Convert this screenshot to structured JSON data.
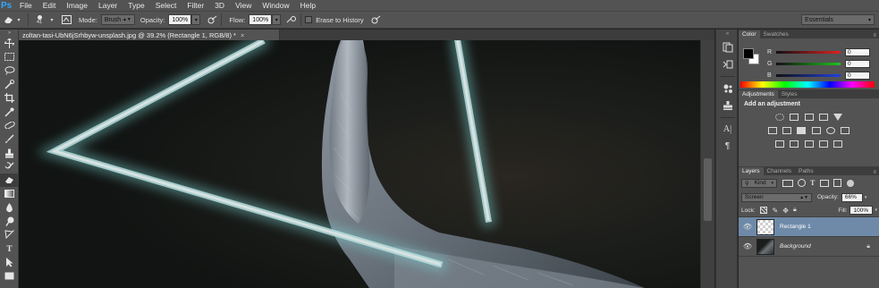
{
  "app": {
    "logo": "Ps",
    "menu": [
      "File",
      "Edit",
      "Image",
      "Layer",
      "Type",
      "Select",
      "Filter",
      "3D",
      "View",
      "Window",
      "Help"
    ]
  },
  "options_bar": {
    "brush_size": "41",
    "mode_label": "Mode:",
    "mode_value": "Brush",
    "opacity_label": "Opacity:",
    "opacity_value": "100%",
    "flow_label": "Flow:",
    "flow_value": "100%",
    "erase_to_history": "Erase to History",
    "workspace": "Essentials"
  },
  "document": {
    "tab_title": "zoltan-tasi-UbN6jSrhbyw-unsplash.jpg @ 39.2% (Rectangle 1, RGB/8) *",
    "close": "×"
  },
  "color_panel": {
    "tabs": [
      "Color",
      "Swatches"
    ],
    "channels": [
      {
        "label": "R",
        "value": "0",
        "color": "#e02020"
      },
      {
        "label": "G",
        "value": "0",
        "color": "#20c020"
      },
      {
        "label": "B",
        "value": "0",
        "color": "#2040e0"
      }
    ]
  },
  "adjustments_panel": {
    "tabs": [
      "Adjustments",
      "Styles"
    ],
    "heading": "Add an adjustment"
  },
  "layers_panel": {
    "tabs": [
      "Layers",
      "Channels",
      "Paths"
    ],
    "filter_label": "Kind",
    "blend_mode": "Screen",
    "opacity_label": "Opacity:",
    "opacity_value": "66%",
    "lock_label": "Lock:",
    "fill_label": "Fill:",
    "fill_value": "100%",
    "layers": [
      {
        "name": "Rectangle 1",
        "selected": true
      },
      {
        "name": "Background",
        "selected": false,
        "locked": true
      }
    ]
  },
  "colors": {
    "accent": "#31a8ff",
    "selection": "#6e8aa8",
    "glow": "#8fd0d0"
  }
}
